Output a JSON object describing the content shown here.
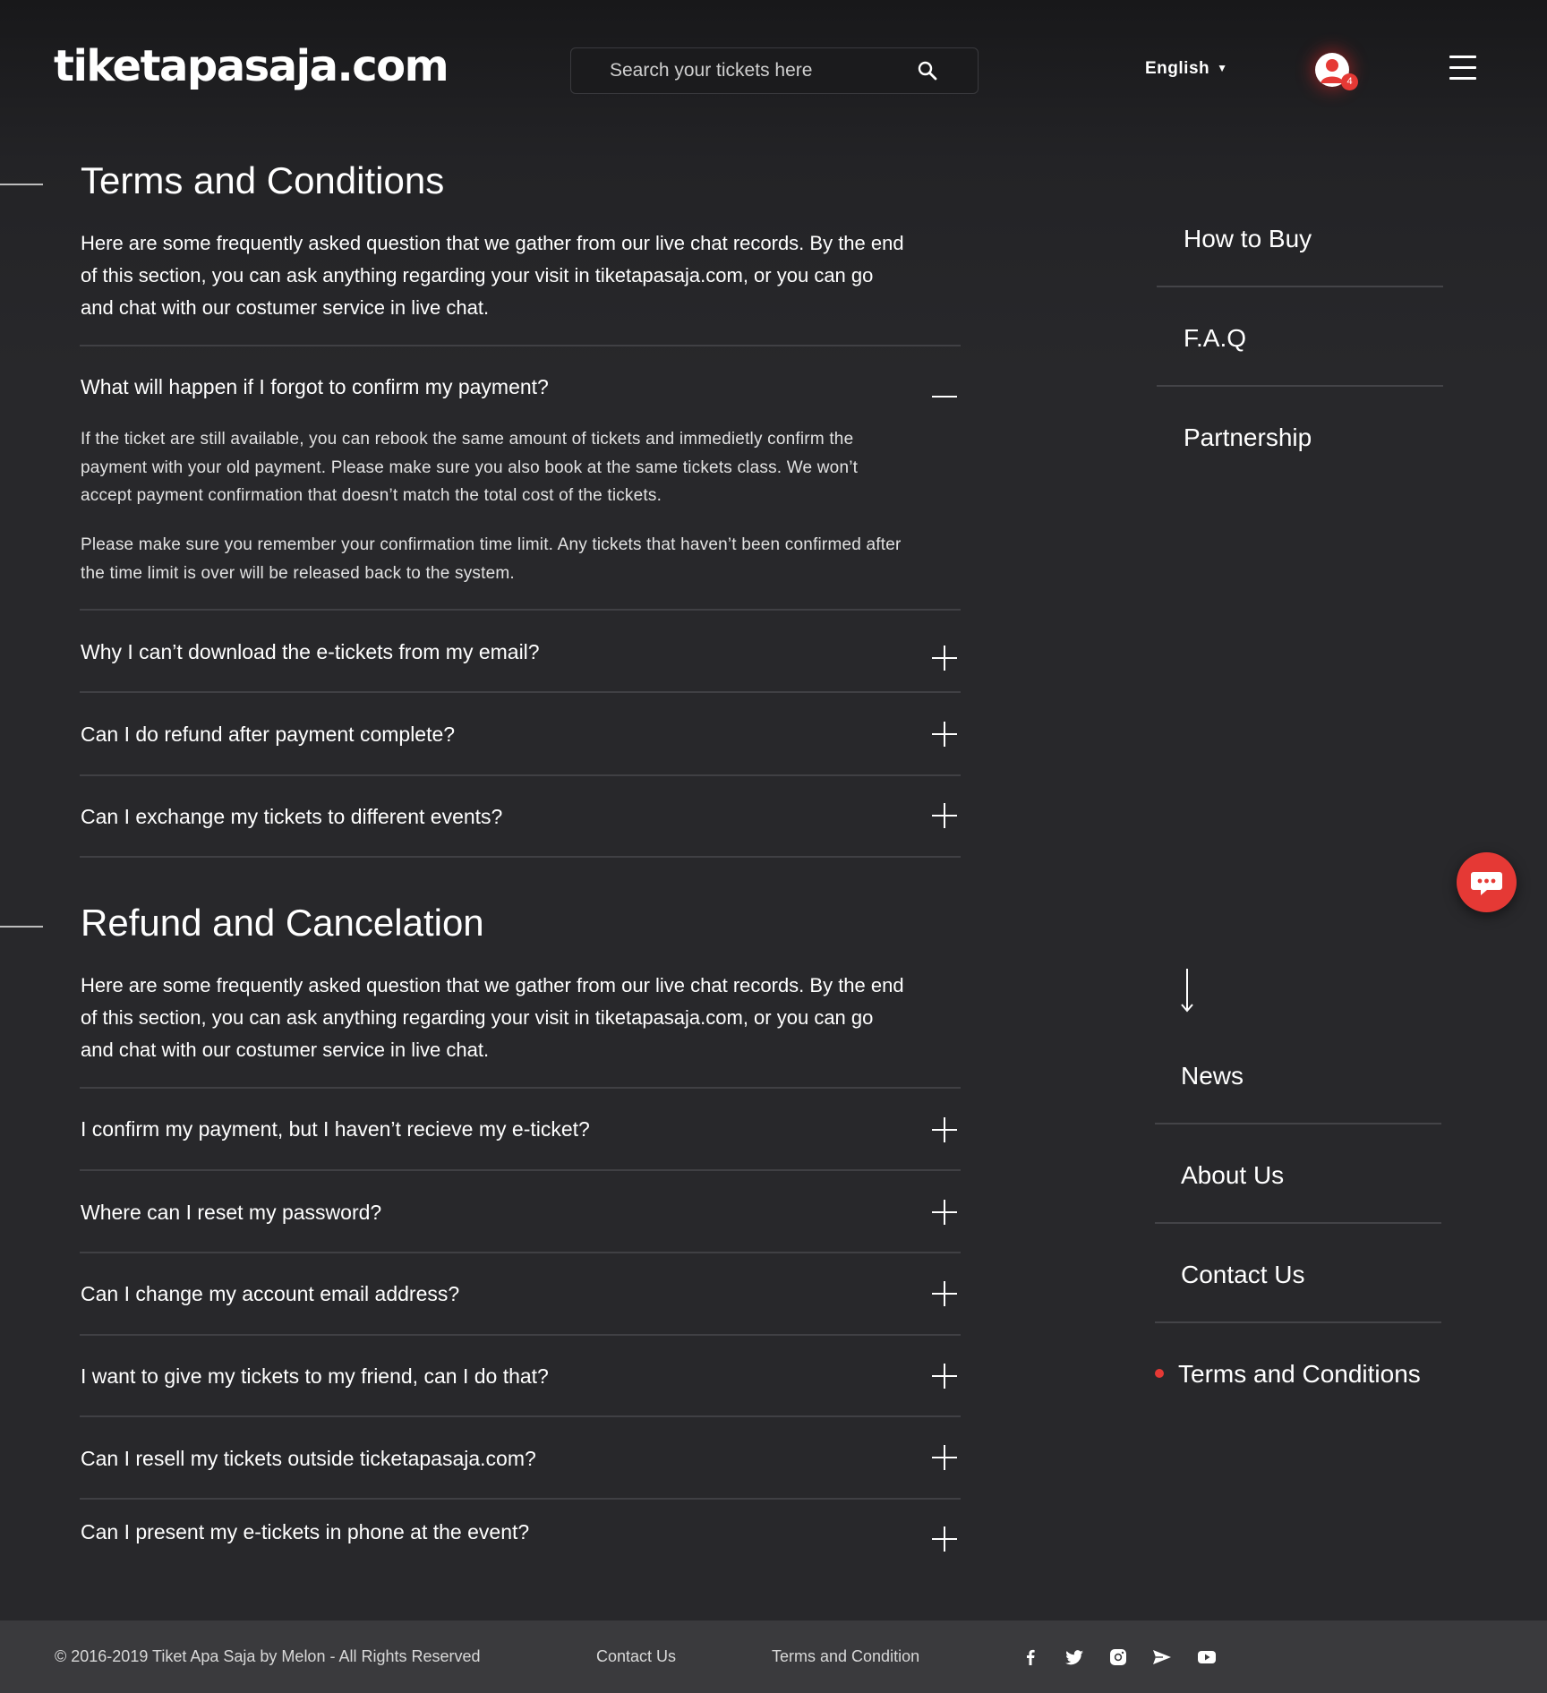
{
  "header": {
    "logo": "tiketapasaja.com",
    "search_placeholder": "Search your tickets here",
    "language": "English",
    "notification_count": "4"
  },
  "terms": {
    "title": "Terms and Conditions",
    "intro": "Here are some frequently asked question that we gather from our live chat records. By the end of this section, you can ask anything regarding your visit in tiketapasaja.com, or you can go and chat with our costumer service in live chat.",
    "faqs": [
      {
        "question": "What will happen if I forgot to confirm my payment?",
        "expanded": true,
        "answer_p1": "If the ticket are still available, you can rebook the same amount of tickets and immedietly confirm the payment with your old payment. Please make sure you also book at the same tickets class. We won’t accept payment confirmation that doesn’t match the total cost of the tickets.",
        "answer_p2": "Please make sure you remember your confirmation time limit. Any tickets that haven’t been confirmed after the time limit is over will be released back to the system."
      },
      {
        "question": "Why I can’t download the e-tickets from my email?",
        "expanded": false
      },
      {
        "question": "Can I do refund after payment complete?",
        "expanded": false
      },
      {
        "question": "Can I exchange my tickets to different events?",
        "expanded": false
      }
    ]
  },
  "refund": {
    "title": "Refund and Cancelation",
    "intro": "Here are some frequently asked question that we gather from our live chat records. By the end of this section, you can ask anything regarding your visit in tiketapasaja.com, or you can go and chat with our costumer service in live chat.",
    "faqs": [
      {
        "question": "I confirm my payment, but I haven’t recieve my e-ticket?",
        "expanded": false
      },
      {
        "question": "Where can I reset my password?",
        "expanded": false
      },
      {
        "question": "Can I change my account email address?",
        "expanded": false
      },
      {
        "question": "I want to give my tickets to my friend, can I do that?",
        "expanded": false
      },
      {
        "question": "Can I resell my tickets outside ticketapasaja.com?",
        "expanded": false
      },
      {
        "question": "Can I present my e-tickets in phone at the event?",
        "expanded": false
      }
    ]
  },
  "side_nav_top": [
    "How to Buy",
    "F.A.Q",
    "Partnership"
  ],
  "side_nav_bottom": [
    "News",
    "About Us",
    "Contact Us",
    "Terms and Conditions"
  ],
  "side_nav_active": "Terms and Conditions",
  "footer": {
    "copyright": "© 2016-2019 Tiket Apa Saja by Melon - All Rights Reserved",
    "links": [
      "Contact Us",
      "Terms and Condition"
    ],
    "social": [
      "facebook-icon",
      "twitter-icon",
      "instagram-icon",
      "telegram-icon",
      "youtube-icon"
    ]
  },
  "colors": {
    "accent": "#e53935",
    "background": "#28282b",
    "footer": "#3a3a3d"
  }
}
